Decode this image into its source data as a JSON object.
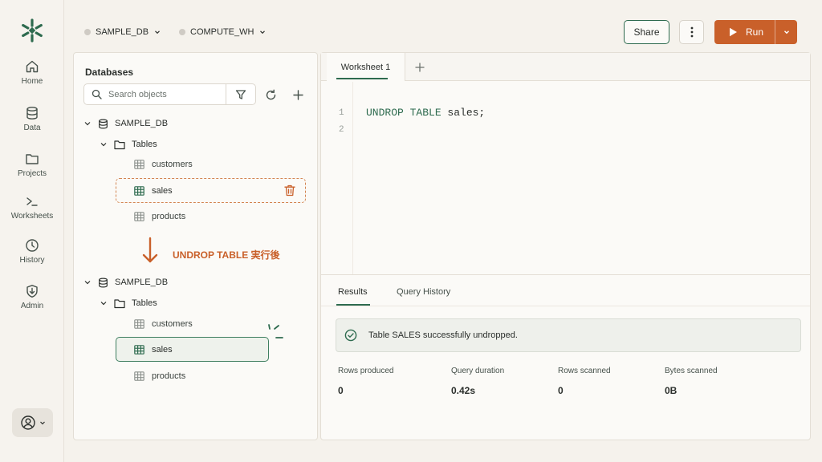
{
  "topbar": {
    "database": "SAMPLE_DB",
    "warehouse": "COMPUTE_WH",
    "share_label": "Share",
    "run_label": "Run"
  },
  "nav": [
    {
      "label": "Home",
      "icon": "home-icon"
    },
    {
      "label": "Data",
      "icon": "database-icon"
    },
    {
      "label": "Projects",
      "icon": "folder-icon"
    },
    {
      "label": "Worksheets",
      "icon": "terminal-icon"
    },
    {
      "label": "History",
      "icon": "clock-icon"
    },
    {
      "label": "Admin",
      "icon": "shield-icon"
    }
  ],
  "databases": {
    "title": "Databases",
    "search_placeholder": "Search objects",
    "before": {
      "db": "SAMPLE_DB",
      "folder": "Tables",
      "tables": [
        "customers",
        "sales",
        "products"
      ]
    },
    "annotation": "UNDROP TABLE 実行後",
    "after": {
      "db": "SAMPLE_DB",
      "folder": "Tables",
      "tables": [
        "customers",
        "sales",
        "products"
      ]
    }
  },
  "worksheet": {
    "tab": "Worksheet 1",
    "add_tab": "+",
    "line_numbers": [
      "1",
      "2"
    ],
    "code_keyword": "UNDROP TABLE",
    "code_rest": " sales;"
  },
  "results": {
    "tabs": [
      "Results",
      "Query History"
    ],
    "message": "Table SALES successfully undropped.",
    "stats": [
      {
        "label": "Rows produced",
        "value": "0"
      },
      {
        "label": "Query duration",
        "value": "0.42s"
      },
      {
        "label": "Rows scanned",
        "value": "0"
      },
      {
        "label": "Bytes scanned",
        "value": "0B"
      }
    ]
  },
  "colors": {
    "accent_green": "#2e6b4f",
    "run_orange": "#c9602a",
    "background": "#f5f2ec"
  }
}
